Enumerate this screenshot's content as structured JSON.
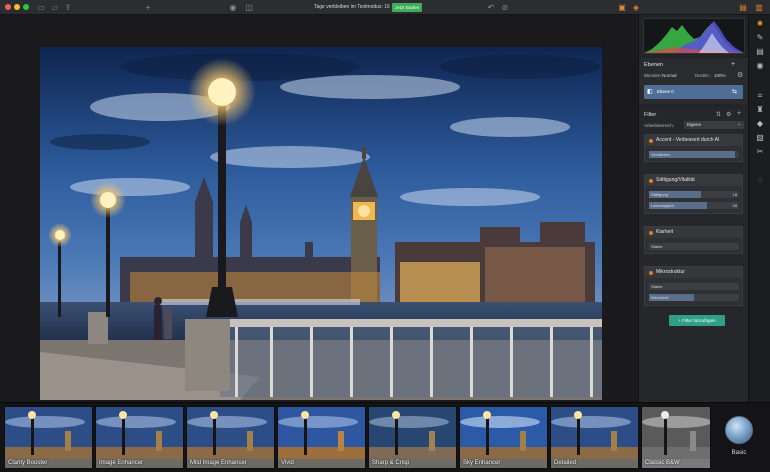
{
  "titlebar": {
    "traffic_colors": [
      "#ff5f57",
      "#febc2e",
      "#28c840"
    ],
    "trial_text": "Tage verbleiben im Testmodus: 16",
    "buy_label": "Jetzt kaufen",
    "icons": [
      "folder-open-icon",
      "folder-icon",
      "share-icon",
      "zoom-in-icon",
      "eye-icon",
      "compare-icon",
      "undo-icon",
      "history-icon",
      "image-icon",
      "layers-icon",
      "panel-toggle-icon",
      "sidebar-icon"
    ]
  },
  "panel": {
    "layers": {
      "title": "Ebenen",
      "blend_label": "Blenden:",
      "blend_value": "Normal",
      "opacity_label": "Deckkr.:",
      "opacity_value": "100%",
      "layer_name": "Ebene 0"
    },
    "filter": {
      "title": "Filter",
      "workspace_label": "Arbeitsbereich:",
      "workspace_value": "Eigene",
      "cards": [
        {
          "title": "Accent - Verbessert durch AI",
          "sliders": [
            {
              "label": "Verstärken",
              "value": "",
              "fill": 0.96
            }
          ]
        },
        {
          "title": "Sättigung/Vitalität",
          "sliders": [
            {
              "label": "Sättigung",
              "value": "18",
              "fill": 0.58
            },
            {
              "label": "Lebendigkeit",
              "value": "28",
              "fill": 0.64
            }
          ]
        },
        {
          "title": "Klarheit",
          "sliders": [
            {
              "label": "Stärke",
              "value": "",
              "fill": 0.0
            }
          ]
        },
        {
          "title": "Mikrostruktur",
          "sliders": [
            {
              "label": "Stärke",
              "value": "",
              "fill": 0.0
            },
            {
              "label": "Weichheit",
              "value": "",
              "fill": 0.5
            }
          ]
        }
      ],
      "add_label": "+ Filter hinzufügen"
    }
  },
  "presets": [
    {
      "name": "Clarity Booster"
    },
    {
      "name": "Image Enhancer"
    },
    {
      "name": "Mild Image Enhancer"
    },
    {
      "name": "Vivid"
    },
    {
      "name": "Sharp & Crisp"
    },
    {
      "name": "Sky Enhancer"
    },
    {
      "name": "Detailed"
    },
    {
      "name": "Classic B&W"
    }
  ],
  "basic_label": "Basic",
  "tools": [
    "accent-icon",
    "brush-icon",
    "gradient-icon",
    "radial-icon",
    "crop-icon",
    "clone-stamp-icon",
    "eraser-icon",
    "transform-icon",
    "luminosity-icon",
    "lasso-icon"
  ]
}
